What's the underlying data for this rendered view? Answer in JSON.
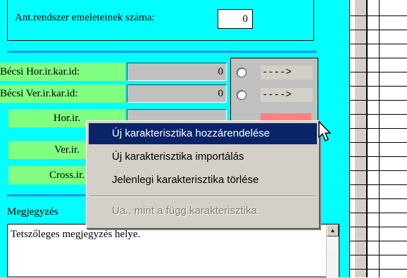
{
  "floors": {
    "label": "Ant.rendszer emeleteinek száma:",
    "value": "0"
  },
  "rows": [
    {
      "label": "Bécsi Hor.ir.kar.id:",
      "value": "0"
    },
    {
      "label": "Bécsi Ver.ir.kar.id:",
      "value": "0"
    },
    {
      "label": "Hor.ir.",
      "value": ""
    },
    {
      "label": "Ver.ir.",
      "value": ""
    },
    {
      "label": "Cross.ir.",
      "value": ""
    }
  ],
  "radio_options": [
    {
      "text": "---->"
    },
    {
      "text": "---->"
    }
  ],
  "comment": {
    "label": "Megjegyzés",
    "text": "Tetszőleges megjegyzés helye."
  },
  "context_menu": {
    "items": [
      {
        "label": "Új karakterisztika hozzárendelése",
        "state": "highlighted"
      },
      {
        "label": "Új karakterisztika importálás",
        "state": "enabled"
      },
      {
        "label": "Jelenlegi karakterisztika törlése",
        "state": "enabled"
      },
      {
        "label": "Ua., mint a függ.karakterisztika",
        "state": "disabled"
      }
    ]
  },
  "colors": {
    "panel": "#00ffff",
    "label_green": "#80ff80",
    "separator": "#1e90ff",
    "menu_highlight": "#0a246a",
    "red_field": "#ff8080"
  }
}
